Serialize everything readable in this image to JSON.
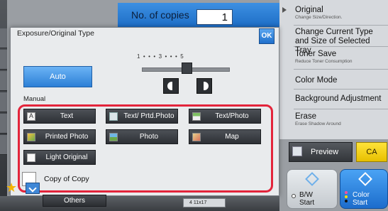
{
  "copies": {
    "label": "No. of copies",
    "value": "1"
  },
  "right_menu": [
    {
      "title": "Original",
      "subtitle": "Change Size/Direction."
    },
    {
      "title": "Change Current Type and Size of Selected Tray",
      "subtitle": ""
    },
    {
      "title": "Toner Save",
      "subtitle": "Reduce Toner Consumption"
    },
    {
      "title": "Color Mode",
      "subtitle": ""
    },
    {
      "title": "Background Adjustment",
      "subtitle": ""
    },
    {
      "title": "Erase",
      "subtitle": "Erase Shadow Around"
    }
  ],
  "dialog": {
    "title": "Exposure/Original Type",
    "ok_label": "OK",
    "auto_label": "Auto",
    "scale_text": "1  •  •  •  3  •  •  •  5",
    "exposure_level": 3,
    "manual_label": "Manual",
    "types": [
      {
        "label": "Text",
        "icon": "text-icon"
      },
      {
        "label": "Text/ Prtd.Photo",
        "icon": "printed-photo-icon"
      },
      {
        "label": "Text/Photo",
        "icon": "text-photo-icon"
      },
      {
        "label": "Printed Photo",
        "icon": "printed-photo-icon"
      },
      {
        "label": "Photo",
        "icon": "photo-icon"
      },
      {
        "label": "Map",
        "icon": "map-icon"
      },
      {
        "label": "Light Original",
        "icon": "light-original-icon"
      }
    ],
    "copy_of_copy_label": "Copy of Copy"
  },
  "bottom": {
    "others_label": "Others",
    "status_text": "4   11x17",
    "preview_label": "Preview",
    "ca_label": "CA",
    "bw_start_label": "B/W\nStart",
    "color_start_label": "Color\nStart"
  },
  "colors": {
    "accent_blue": "#2d80d6",
    "highlight_red": "#e3243b",
    "ca_yellow": "#ffe33a"
  }
}
